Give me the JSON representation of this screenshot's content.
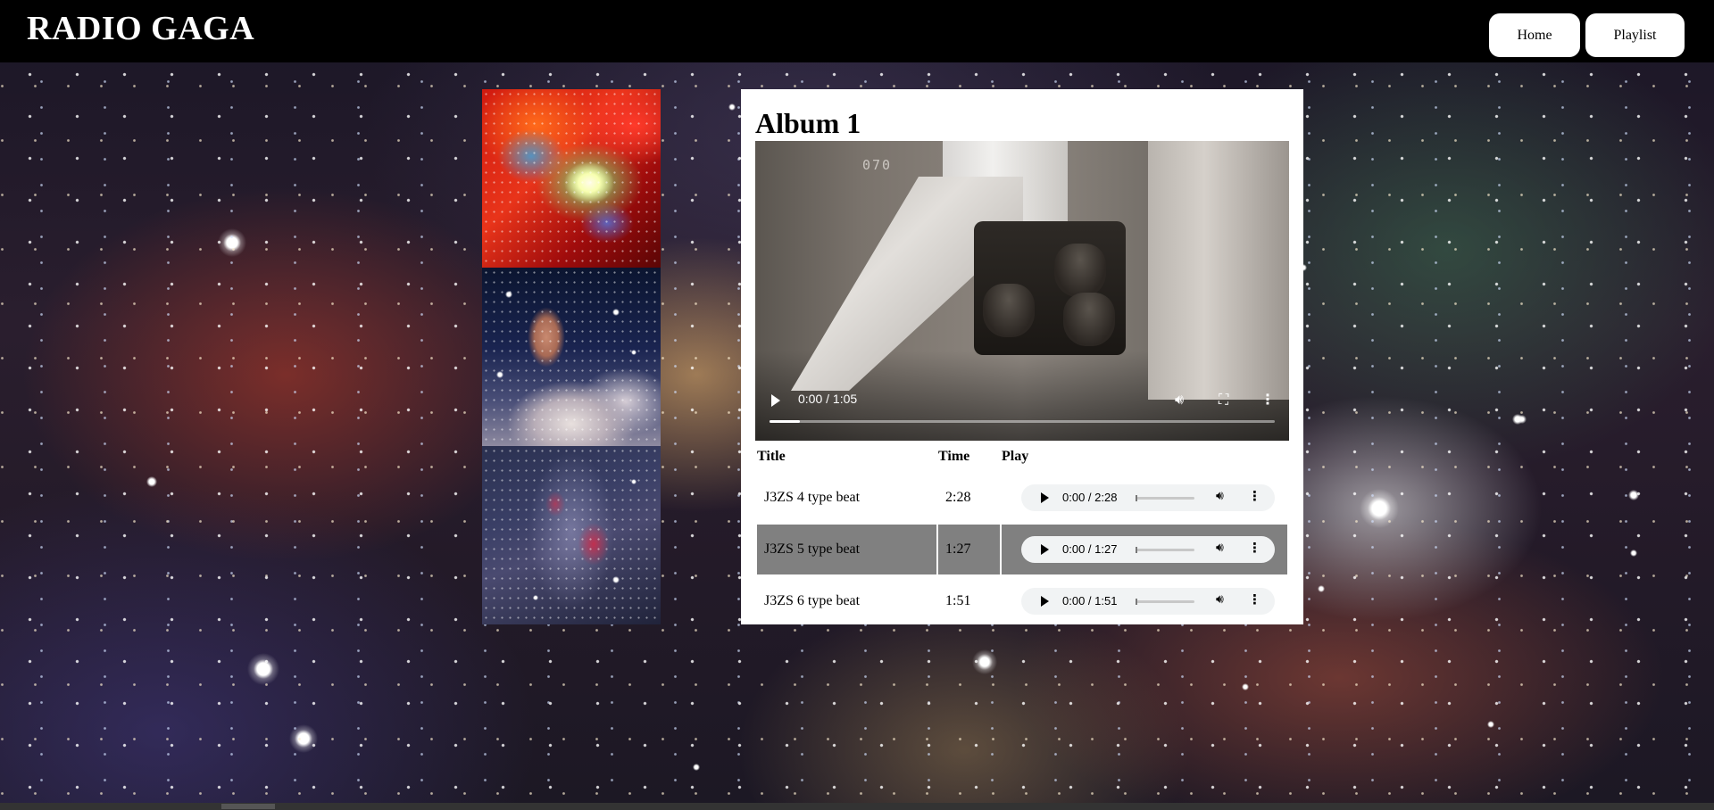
{
  "header": {
    "brand": "RADIO GAGA",
    "nav": [
      {
        "label": "Home"
      },
      {
        "label": "Playlist"
      }
    ]
  },
  "album_art": [
    {
      "name": "orion-nebula-art"
    },
    {
      "name": "horsehead-nebula-art"
    },
    {
      "name": "milky-way-art"
    }
  ],
  "album": {
    "title": "Album 1",
    "video": {
      "overlay_text": "070",
      "time": "0:00 / 1:05",
      "progress": 0.06,
      "icons": {
        "play": "play-icon",
        "volume": "volume-icon",
        "fullscreen": "fullscreen-icon",
        "more": "more-options-icon"
      }
    },
    "columns": {
      "title": "Title",
      "time": "Time",
      "play": "Play"
    },
    "tracks": [
      {
        "title": "J3ZS 4 type beat",
        "time": "2:28",
        "player_time": "0:00 / 2:28"
      },
      {
        "title": "J3ZS 5 type beat",
        "time": "1:27",
        "player_time": "0:00 / 1:27"
      },
      {
        "title": "J3ZS 6 type beat",
        "time": "1:51",
        "player_time": "0:00 / 1:51"
      }
    ]
  },
  "colors": {
    "header_bg": "#000000",
    "card_bg": "#ffffff",
    "row_highlight": "#808080",
    "audio_bg": "#f1f3f4"
  }
}
